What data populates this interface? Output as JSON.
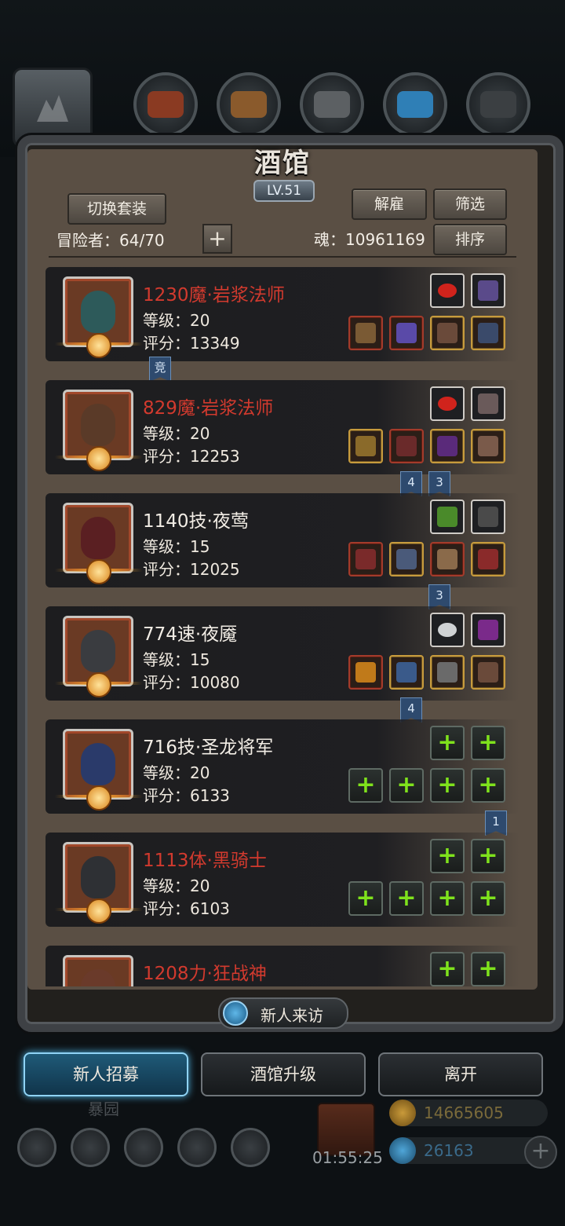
{
  "app": {
    "title": "酒馆",
    "level": "LV.51"
  },
  "buttons": {
    "switch_set": "切换套装",
    "dismiss": "解雇",
    "filter": "筛选",
    "sort": "排序",
    "add": "+",
    "visitor": "新人来访"
  },
  "info": {
    "adventurers_label": "冒险者：",
    "adventurers_value": "64/70",
    "soul_label": "魂：",
    "soul_value": "10961169"
  },
  "heroes": [
    {
      "name": "1230魔·岩浆法师",
      "level": "等级：20",
      "score": "评分：13349",
      "name_color": "red"
    },
    {
      "name": "829魔·岩浆法师",
      "level": "等级：20",
      "score": "评分：12253",
      "name_color": "red"
    },
    {
      "name": "1140技·夜莺",
      "level": "等级：15",
      "score": "评分：12025",
      "name_color": "white"
    },
    {
      "name": "774速·夜魇",
      "level": "等级：15",
      "score": "评分：10080",
      "name_color": "white"
    },
    {
      "name": "716技·圣龙将军",
      "level": "等级：20",
      "score": "评分：6133",
      "name_color": "white"
    },
    {
      "name": "1113体·黑骑士",
      "level": "等级：20",
      "score": "评分：6103",
      "name_color": "red"
    },
    {
      "name": "1208力·狂战神",
      "name_color": "red"
    }
  ],
  "tags": {
    "row1": "竞",
    "row2_a": "4",
    "row2_b": "3",
    "row3": "3",
    "row4": "4",
    "row5": "1"
  },
  "bottom_buttons": {
    "recruit": "新人招募",
    "upgrade": "酒馆升级",
    "leave": "离开"
  },
  "background": {
    "garden_label": "暴园",
    "timer": "01:55:25",
    "gold": "14665605",
    "gems": "26163",
    "plus": "+"
  },
  "colors": {
    "name_red": "#d23a2e",
    "accent_blue": "#8fd3f5",
    "slot_plus_green": "#7fe21c"
  }
}
